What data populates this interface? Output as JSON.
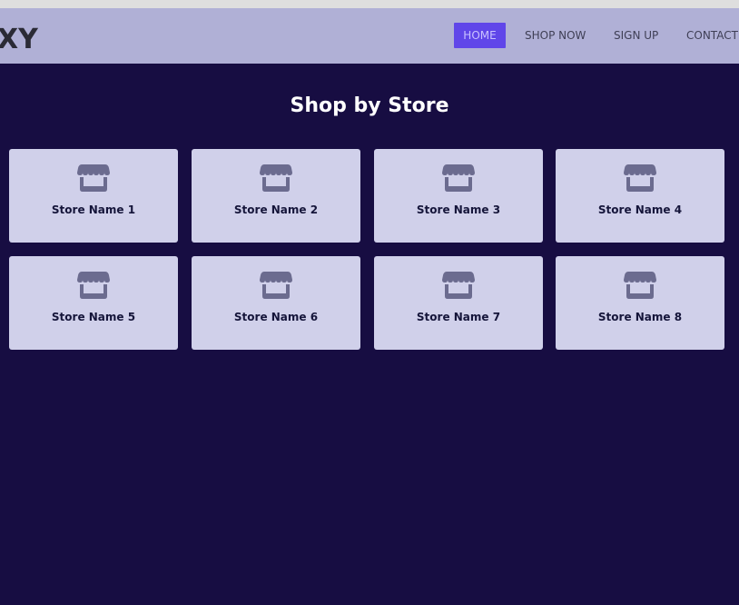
{
  "header": {
    "logo": "XY",
    "nav": [
      {
        "label": "HOME",
        "active": true
      },
      {
        "label": "SHOP NOW",
        "active": false
      },
      {
        "label": "SIGN UP",
        "active": false
      },
      {
        "label": "CONTACT",
        "active": false
      }
    ]
  },
  "main": {
    "title": "Shop by Store",
    "stores": [
      {
        "name": "Store Name 1",
        "icon": "store-icon"
      },
      {
        "name": "Store Name 2",
        "icon": "store-icon"
      },
      {
        "name": "Store Name 3",
        "icon": "store-icon"
      },
      {
        "name": "Store Name 4",
        "icon": "store-icon"
      },
      {
        "name": "Store Name 5",
        "icon": "store-icon"
      },
      {
        "name": "Store Name 6",
        "icon": "store-icon"
      },
      {
        "name": "Store Name 7",
        "icon": "store-icon"
      },
      {
        "name": "Store Name 8",
        "icon": "store-icon"
      }
    ]
  },
  "colors": {
    "background": "#170d42",
    "navbar": "#b0b0d6",
    "accent": "#6046e9",
    "card": "#d0d0ea",
    "icon": "#6b6b8f"
  }
}
